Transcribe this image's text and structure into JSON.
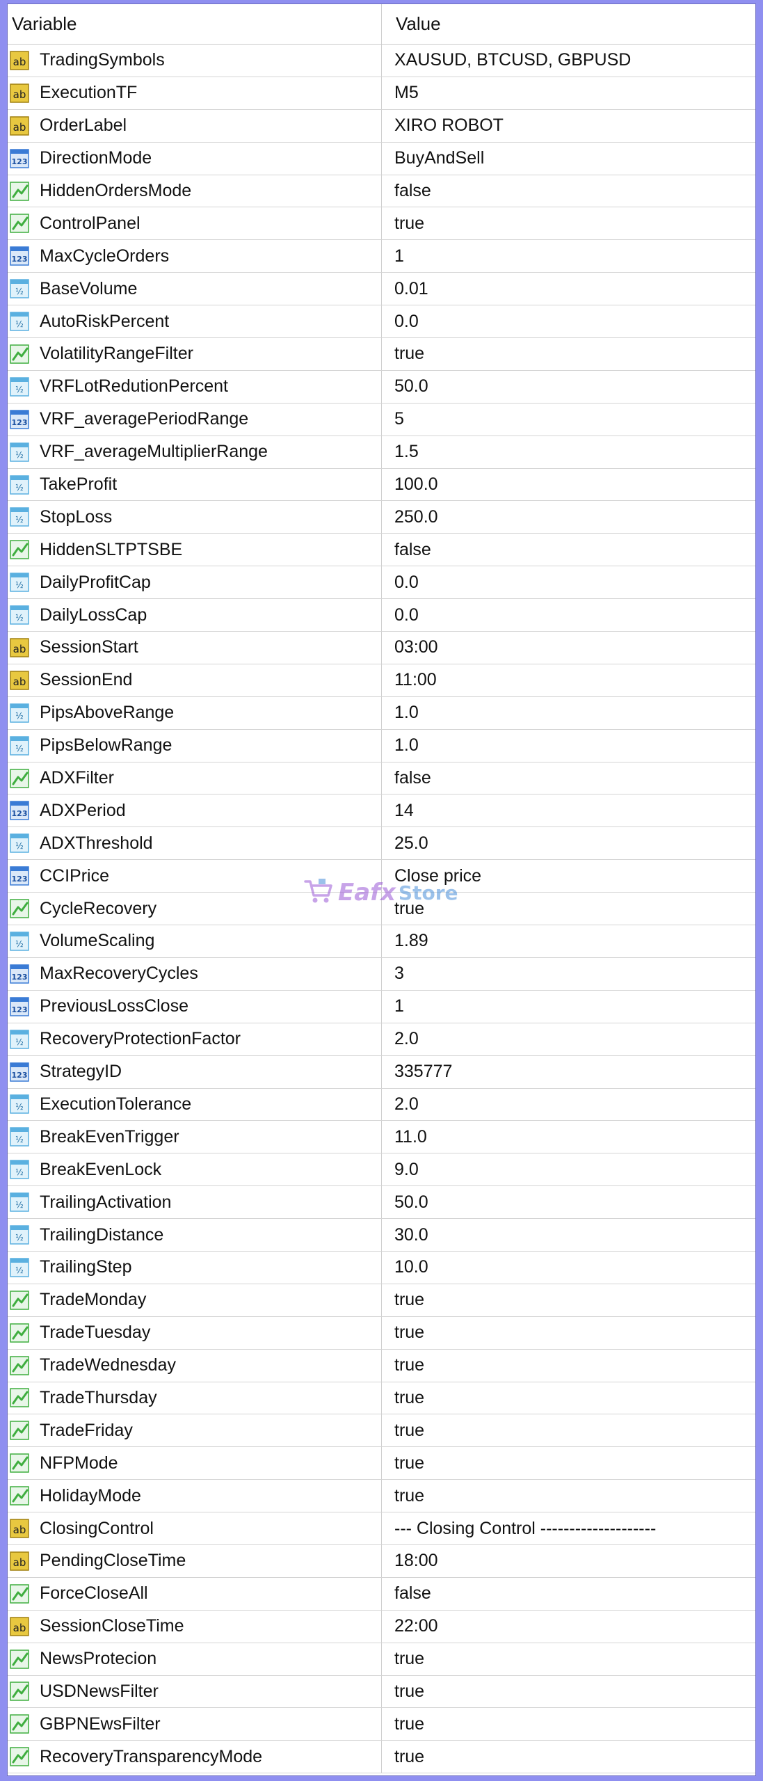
{
  "header": {
    "variable": "Variable",
    "value": "Value"
  },
  "rows": [
    {
      "name": "TradingSymbols",
      "value": "XAUSUD, BTCUSD, GBPUSD",
      "type": "ab"
    },
    {
      "name": "ExecutionTF",
      "value": "M5",
      "type": "ab"
    },
    {
      "name": "OrderLabel",
      "value": "XIRO ROBOT",
      "type": "ab"
    },
    {
      "name": "DirectionMode",
      "value": "BuyAndSell",
      "type": "int"
    },
    {
      "name": "HiddenOrdersMode",
      "value": "false",
      "type": "bool"
    },
    {
      "name": "ControlPanel",
      "value": "true",
      "type": "bool"
    },
    {
      "name": "MaxCycleOrders",
      "value": "1",
      "type": "int"
    },
    {
      "name": "BaseVolume",
      "value": "0.01",
      "type": "dbl"
    },
    {
      "name": "AutoRiskPercent",
      "value": "0.0",
      "type": "dbl"
    },
    {
      "name": "VolatilityRangeFilter",
      "value": "true",
      "type": "bool"
    },
    {
      "name": "VRFLotRedutionPercent",
      "value": "50.0",
      "type": "dbl"
    },
    {
      "name": "VRF_averagePeriodRange",
      "value": "5",
      "type": "int"
    },
    {
      "name": "VRF_averageMultiplierRange",
      "value": "1.5",
      "type": "dbl"
    },
    {
      "name": "TakeProfit",
      "value": "100.0",
      "type": "dbl"
    },
    {
      "name": "StopLoss",
      "value": "250.0",
      "type": "dbl"
    },
    {
      "name": "HiddenSLTPTSBE",
      "value": "false",
      "type": "bool"
    },
    {
      "name": "DailyProfitCap",
      "value": "0.0",
      "type": "dbl"
    },
    {
      "name": "DailyLossCap",
      "value": "0.0",
      "type": "dbl"
    },
    {
      "name": "SessionStart",
      "value": "03:00",
      "type": "ab"
    },
    {
      "name": "SessionEnd",
      "value": "11:00",
      "type": "ab"
    },
    {
      "name": "PipsAboveRange",
      "value": "1.0",
      "type": "dbl"
    },
    {
      "name": "PipsBelowRange",
      "value": "1.0",
      "type": "dbl"
    },
    {
      "name": "ADXFilter",
      "value": "false",
      "type": "bool"
    },
    {
      "name": "ADXPeriod",
      "value": "14",
      "type": "int"
    },
    {
      "name": "ADXThreshold",
      "value": "25.0",
      "type": "dbl"
    },
    {
      "name": "CCIPrice",
      "value": "Close price",
      "type": "int"
    },
    {
      "name": "CycleRecovery",
      "value": "true",
      "type": "bool"
    },
    {
      "name": "VolumeScaling",
      "value": "1.89",
      "type": "dbl"
    },
    {
      "name": "MaxRecoveryCycles",
      "value": "3",
      "type": "int"
    },
    {
      "name": "PreviousLossClose",
      "value": "1",
      "type": "int"
    },
    {
      "name": "RecoveryProtectionFactor",
      "value": "2.0",
      "type": "dbl"
    },
    {
      "name": "StrategyID",
      "value": "335777",
      "type": "int"
    },
    {
      "name": "ExecutionTolerance",
      "value": "2.0",
      "type": "dbl"
    },
    {
      "name": "BreakEvenTrigger",
      "value": "11.0",
      "type": "dbl"
    },
    {
      "name": "BreakEvenLock",
      "value": "9.0",
      "type": "dbl"
    },
    {
      "name": "TrailingActivation",
      "value": "50.0",
      "type": "dbl"
    },
    {
      "name": "TrailingDistance",
      "value": "30.0",
      "type": "dbl"
    },
    {
      "name": "TrailingStep",
      "value": "10.0",
      "type": "dbl"
    },
    {
      "name": "TradeMonday",
      "value": "true",
      "type": "bool"
    },
    {
      "name": "TradeTuesday",
      "value": "true",
      "type": "bool"
    },
    {
      "name": "TradeWednesday",
      "value": "true",
      "type": "bool"
    },
    {
      "name": "TradeThursday",
      "value": "true",
      "type": "bool"
    },
    {
      "name": "TradeFriday",
      "value": "true",
      "type": "bool"
    },
    {
      "name": "NFPMode",
      "value": "true",
      "type": "bool"
    },
    {
      "name": "HolidayMode",
      "value": "true",
      "type": "bool"
    },
    {
      "name": "ClosingControl",
      "value": "--- Closing Control --------------------",
      "type": "ab"
    },
    {
      "name": "PendingCloseTime",
      "value": "18:00",
      "type": "ab"
    },
    {
      "name": "ForceCloseAll",
      "value": "false",
      "type": "bool"
    },
    {
      "name": "SessionCloseTime",
      "value": "22:00",
      "type": "ab"
    },
    {
      "name": "NewsProtecion",
      "value": "true",
      "type": "bool"
    },
    {
      "name": "USDNewsFilter",
      "value": "true",
      "type": "bool"
    },
    {
      "name": "GBPNEwsFilter",
      "value": "true",
      "type": "bool"
    },
    {
      "name": "RecoveryTransparencyMode",
      "value": "true",
      "type": "bool"
    }
  ],
  "watermark": {
    "brand": "Eafx",
    "suffix": "Store"
  },
  "colors": {
    "background": "#8f8ff0",
    "icon_string": "#e8c840",
    "icon_int": "#3a7bd5",
    "icon_double": "#5ab0e0",
    "icon_bool": "#3fae3f"
  }
}
